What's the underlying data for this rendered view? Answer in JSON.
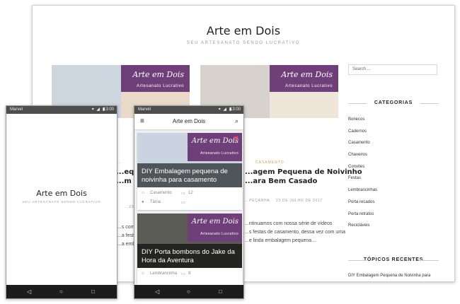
{
  "desktop": {
    "site_title": "Arte em Dois",
    "tagline": "SEU ARTESANATO SENDO LUCRATIVO",
    "banner_logo": "Arte em Dois",
    "banner_subtitle": "Artesanato Lucrativo",
    "posts": [
      {
        "category": "...",
        "heading_line1": "...eque",
        "heading_line2": "...m Ca",
        "meta": "...23",
        "excerpt_line1": "...s com n",
        "excerpt_line2": "...a festas",
        "excerpt_line3": "...a emb"
      },
      {
        "category": "CASAMENTO",
        "heading_line1": "...agem Pequena de Noivinho",
        "heading_line2": "...ara Bem Casado",
        "meta_author": "...PEÇANHA",
        "meta_date": "23 DE JULHO DE 2017",
        "excerpt_line1": "...ntinuamos com nossa série de vídeos",
        "excerpt_line2": "...s festas de casamento, dessa vez com uma",
        "excerpt_line3": "...e linda embalagem pequena…"
      }
    ],
    "search_placeholder": "Search ...",
    "categories_heading": "CATEGORIAS",
    "categories": [
      "Bonecos",
      "Cadernos",
      "Casamento",
      "Chaveiros",
      "Convites",
      "Festas",
      "Lembrancinhas",
      "Porta recados",
      "Porta retratos",
      "Recicláveis"
    ],
    "recent_heading": "TÓPICOS RECENTES",
    "recent_first": "DIY Embalagem Pequena de Noivinha para"
  },
  "phone_status": {
    "carrier": "Marvel",
    "icons": "▾ ◢ ▮",
    "time": "13:00"
  },
  "phone1": {
    "title": "Arte em Dois",
    "tagline": "SEU ARTESANATO SENDO LUCRATIVO"
  },
  "phone2": {
    "app_title": "Arte em Dois",
    "menu_glyph": "≡",
    "search_glyph": "⌕",
    "banner_logo": "Arte em Dois",
    "banner_subtitle": "Artesanato Lucrativo",
    "cards": [
      {
        "title": "DIY Embalagem pequena de noivinha para casamento",
        "category": "Casamento",
        "comments": "12",
        "author": "Tânia",
        "heart": "♥"
      },
      {
        "title": "DIY Porta bombons do Jake da Hora da Aventura",
        "category": "Lembrancinha",
        "comments": "8",
        "author": "",
        "heart": "♡"
      }
    ]
  },
  "navbar": {
    "back": "◁",
    "home": "○",
    "recents": "□"
  },
  "colors": {
    "brand_purple": "#6e3f78",
    "category_gold": "#c9a44b",
    "status_bar": "#4d4d4d",
    "nav_bar": "#1c1c1c"
  }
}
